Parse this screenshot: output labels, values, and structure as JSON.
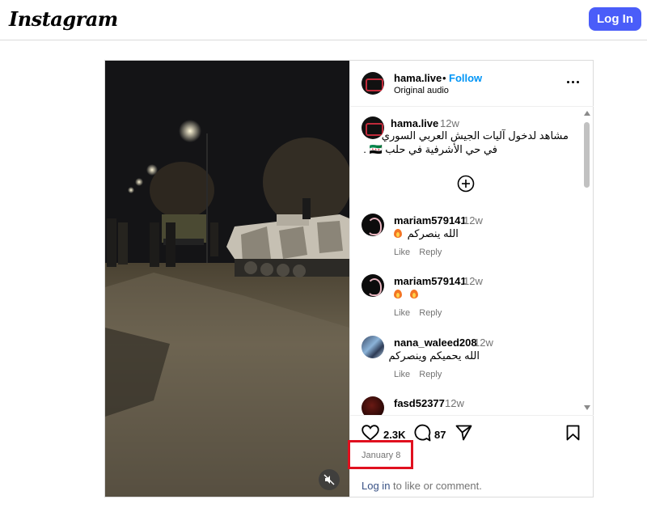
{
  "app": {
    "logo": "Instagram",
    "login_button": "Log In"
  },
  "header": {
    "username": "hama.live",
    "separator": "•",
    "follow": "Follow",
    "audio": "Original audio"
  },
  "caption": {
    "username": "hama.live",
    "time": "12w",
    "line1": "مشاهد لدخول آليات الجيش العربي السوري",
    "line2": "في حي الأشرفية في حلب 🇸🇾 ."
  },
  "comments": [
    {
      "username": "mariam579141",
      "time": "12w",
      "text": "الله ينصركم",
      "fires": 1,
      "like": "Like",
      "reply": "Reply"
    },
    {
      "username": "mariam579141",
      "time": "12w",
      "text": "",
      "fires": 2,
      "like": "Like",
      "reply": "Reply"
    },
    {
      "username": "nana_waleed208",
      "time": "12w",
      "text": "الله يحميكم وينصركم",
      "fires": 0,
      "like": "Like",
      "reply": "Reply"
    },
    {
      "username": "fasd52377",
      "time": "12w",
      "text": "",
      "fires": 0,
      "like": "",
      "reply": ""
    }
  ],
  "actions": {
    "likes": "2.3K",
    "comments": "87"
  },
  "date": "January 8",
  "footer": {
    "login_link": "Log in",
    "suffix": " to like or comment."
  },
  "colors": {
    "follow": "#0095f6",
    "login_button": "#4a5df9",
    "highlight_box": "#e0101f"
  },
  "icons": [
    "more-options-icon",
    "add-comment-icon",
    "heart-icon",
    "comment-icon",
    "share-icon",
    "bookmark-icon",
    "mute-icon"
  ]
}
